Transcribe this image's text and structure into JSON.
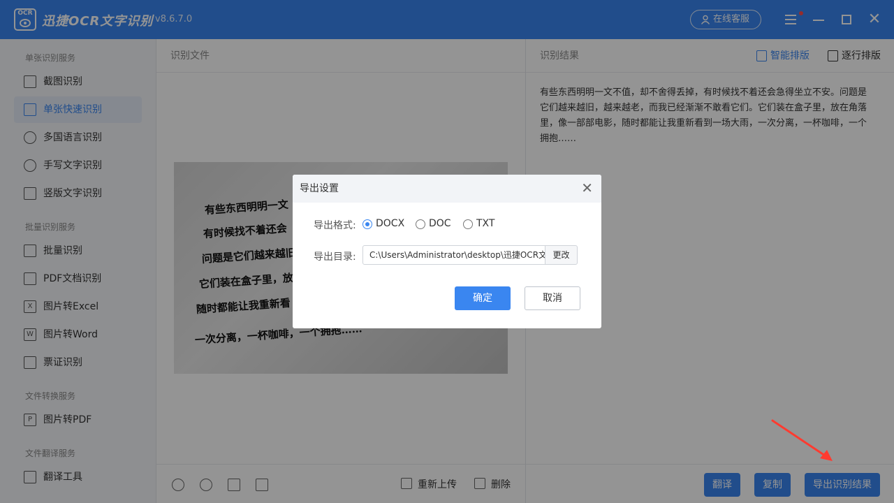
{
  "titlebar": {
    "logo_text": "OCR",
    "app_name": "迅捷OCR文字识别",
    "version": "v8.6.7.0",
    "service_label": "在线客服"
  },
  "sidebar": {
    "sections": [
      {
        "title": "单张识别服务",
        "items": [
          {
            "label": "截图识别",
            "icon": "crop-icon"
          },
          {
            "label": "单张快速识别",
            "icon": "quick-scan-icon",
            "active": true
          },
          {
            "label": "多国语言识别",
            "icon": "globe-icon"
          },
          {
            "label": "手写文字识别",
            "icon": "pen-icon"
          },
          {
            "label": "竖版文字识别",
            "icon": "vertical-text-icon"
          }
        ]
      },
      {
        "title": "批量识别服务",
        "items": [
          {
            "label": "批量识别",
            "icon": "batch-icon"
          },
          {
            "label": "PDF文档识别",
            "icon": "pdf-icon"
          },
          {
            "label": "图片转Excel",
            "icon": "excel-icon",
            "glyph": "X"
          },
          {
            "label": "图片转Word",
            "icon": "word-icon",
            "glyph": "W"
          },
          {
            "label": "票证识别",
            "icon": "id-card-icon"
          }
        ]
      },
      {
        "title": "文件转换服务",
        "items": [
          {
            "label": "图片转PDF",
            "icon": "image-pdf-icon",
            "glyph": "P"
          }
        ]
      },
      {
        "title": "文件翻译服务",
        "items": [
          {
            "label": "翻译工具",
            "icon": "translate-icon"
          }
        ]
      }
    ]
  },
  "middle": {
    "header": "识别文件",
    "image_lines": [
      "有些东西明明一文",
      "有时候找不着还会",
      "问题是它们越来越旧",
      "它们装在盒子里，放",
      "随时都能让我重新看",
      "一次分离，一杯咖啡，一个拥抱……"
    ],
    "reupload_label": "重新上传",
    "delete_label": "删除"
  },
  "right": {
    "header": "识别结果",
    "smart_layout_label": "智能排版",
    "line_layout_label": "逐行排版",
    "result_text": "有些东西明明一文不值，却不舍得丢掉，有时候找不着还会急得坐立不安。问题是它们越来越旧，越来越老，而我已经渐渐不敢看它们。它们装在盒子里，放在角落里，像一部部电影，随时都能让我重新看到一场大雨，一次分离，一杯咖啡，一个拥抱……",
    "translate_label": "翻译",
    "copy_label": "复制",
    "export_label": "导出识别结果"
  },
  "dialog": {
    "title": "导出设置",
    "format_label": "导出格式:",
    "formats": [
      "DOCX",
      "DOC",
      "TXT"
    ],
    "selected_format": "DOCX",
    "dir_label": "导出目录:",
    "dir_value": "C:\\Users\\Administrator\\desktop\\迅捷OCR文字识别",
    "change_label": "更改",
    "ok_label": "确定",
    "cancel_label": "取消"
  },
  "colors": {
    "accent": "#3a86f0",
    "annotation_arrow": "#ff3b30"
  }
}
